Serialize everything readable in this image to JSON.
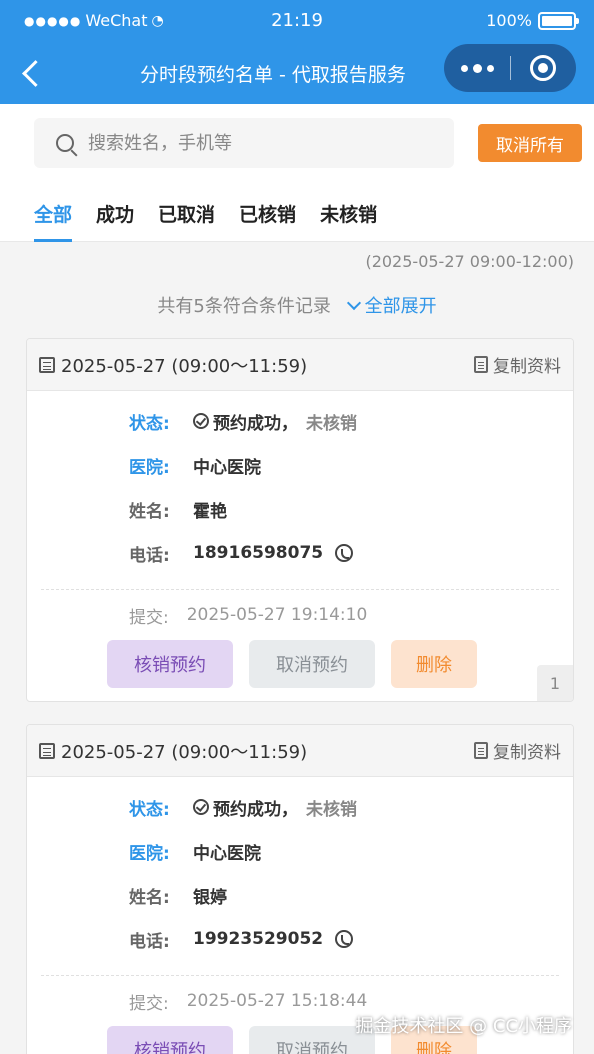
{
  "status_bar": {
    "carrier": "WeChat",
    "time": "21:19",
    "battery": "100%"
  },
  "nav": {
    "title": "分时段预约名单 - 代取报告服务"
  },
  "search": {
    "placeholder": "搜索姓名，手机等",
    "value": ""
  },
  "cancel_all_label": "取消所有",
  "tabs": [
    {
      "label": "全部",
      "active": true
    },
    {
      "label": "成功",
      "active": false
    },
    {
      "label": "已取消",
      "active": false
    },
    {
      "label": "已核销",
      "active": false
    },
    {
      "label": "未核销",
      "active": false
    }
  ],
  "range": "(2025-05-27 09:00-12:00)",
  "summary": {
    "text": "共有5条符合条件记录",
    "expand": "全部展开"
  },
  "labels": {
    "status": "状态:",
    "hospital": "医院:",
    "name": "姓名:",
    "phone": "电话:",
    "submit": "提交:",
    "copy": "复制资料"
  },
  "actions": {
    "verify": "核销预约",
    "cancel": "取消预约",
    "delete": "删除"
  },
  "records": [
    {
      "date": "2025-05-27 (09:00～11:59)",
      "status": "预约成功，",
      "status_sub": "未核销",
      "hospital": "中心医院",
      "name": "霍艳",
      "phone": "18916598075",
      "submitted": "2025-05-27 19:14:10",
      "index": "1"
    },
    {
      "date": "2025-05-27 (09:00～11:59)",
      "status": "预约成功，",
      "status_sub": "未核销",
      "hospital": "中心医院",
      "name": "银婷",
      "phone": "19923529052",
      "submitted": "2025-05-27 15:18:44"
    }
  ],
  "watermark": "掘金技术社区 @ CC小程序",
  "colors": {
    "primary": "#2f95e8",
    "accent": "#f28b2f",
    "verify": "#7a4db5"
  }
}
